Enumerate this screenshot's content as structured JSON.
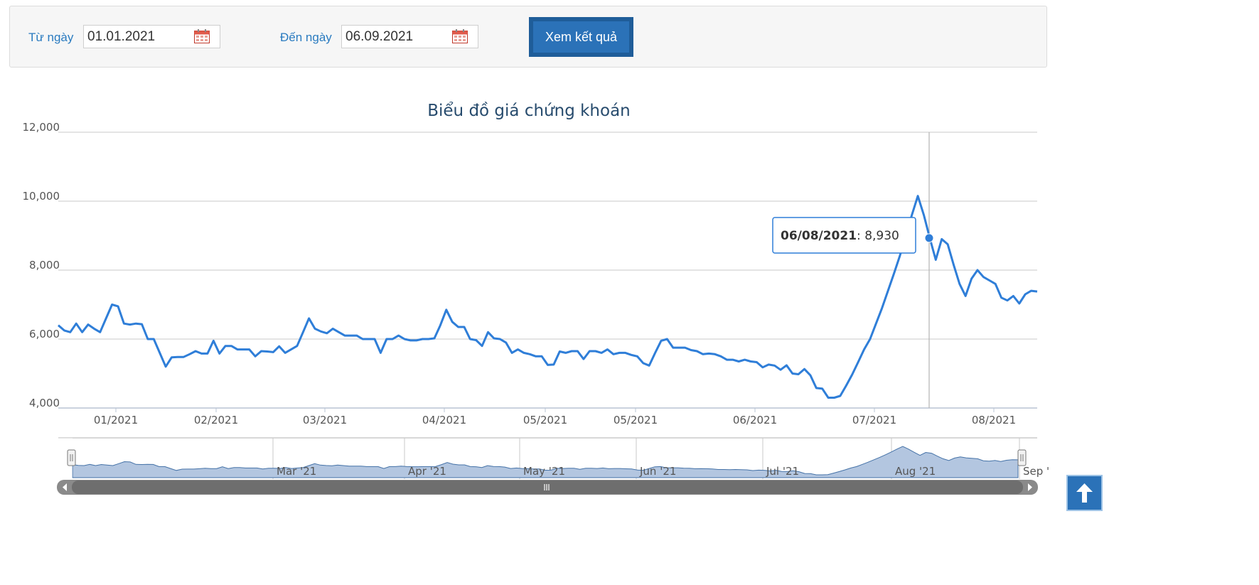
{
  "filter": {
    "from_label": "Từ ngày",
    "from_value": "01.01.2021",
    "to_label": "Đến ngày",
    "to_value": "06.09.2021",
    "submit_label": "Xem kết quả"
  },
  "icons": {
    "calendar": "calendar-icon",
    "scroll_top": "arrow-up-icon",
    "navigator_left": "arrow-left-icon",
    "navigator_right": "arrow-right-icon"
  },
  "colors": {
    "accent": "#2b72b8",
    "line": "#2f7ed8",
    "navigator_fill": "#b3c6e0",
    "label": "#2a7bc0"
  },
  "tooltip": {
    "date": "06/08/2021",
    "value": "8,930"
  },
  "chart_data": {
    "type": "line",
    "title": "Biểu đồ giá chứng khoán",
    "xlabel": "",
    "ylabel": "",
    "ylim": [
      4000,
      12000
    ],
    "yticks": [
      4000,
      6000,
      8000,
      10000,
      12000
    ],
    "ytick_labels": [
      "4,000",
      "6,000",
      "8,000",
      "10,000",
      "12,000"
    ],
    "xtick_labels": [
      "01/2021",
      "02/2021",
      "03/2021",
      "04/2021",
      "05/2021",
      "05/2021",
      "06/2021",
      "07/2021",
      "08/2021"
    ],
    "navigator_labels": [
      "Mar '21",
      "Apr '21",
      "May '21",
      "Jun '21",
      "Jul '21",
      "Aug '21",
      "Sep '"
    ],
    "grid": true,
    "legend": "none",
    "values": [
      6400,
      6250,
      6200,
      6450,
      6200,
      6420,
      6300,
      6200,
      6600,
      7000,
      6950,
      6450,
      6420,
      6450,
      6430,
      6000,
      6000,
      5600,
      5200,
      5470,
      5480,
      5480,
      5560,
      5650,
      5580,
      5580,
      5950,
      5580,
      5800,
      5800,
      5700,
      5700,
      5700,
      5500,
      5650,
      5640,
      5620,
      5790,
      5600,
      5700,
      5800,
      6200,
      6600,
      6300,
      6220,
      6170,
      6300,
      6200,
      6100,
      6100,
      6100,
      6000,
      6000,
      6000,
      5600,
      6000,
      6000,
      6100,
      6000,
      5960,
      5960,
      6000,
      6000,
      6020,
      6400,
      6850,
      6500,
      6350,
      6350,
      6000,
      5970,
      5800,
      6200,
      6020,
      6000,
      5900,
      5600,
      5700,
      5600,
      5560,
      5500,
      5500,
      5250,
      5260,
      5640,
      5600,
      5650,
      5650,
      5420,
      5650,
      5650,
      5600,
      5700,
      5560,
      5600,
      5600,
      5540,
      5500,
      5300,
      5230,
      5600,
      5950,
      6000,
      5750,
      5750,
      5750,
      5680,
      5650,
      5560,
      5580,
      5560,
      5500,
      5400,
      5400,
      5350,
      5400,
      5350,
      5330,
      5180,
      5260,
      5230,
      5110,
      5240,
      5000,
      4980,
      5130,
      4950,
      4580,
      4560,
      4300,
      4300,
      4350,
      4650,
      4970,
      5330,
      5700,
      6000,
      6450,
      6900,
      7400,
      7900,
      8420,
      9000,
      9600,
      10150,
      9600,
      8930,
      8300,
      8900,
      8750,
      8150,
      7600,
      7250,
      7750,
      8000,
      7800,
      7700,
      7600,
      7200,
      7120,
      7250,
      7030,
      7300,
      7400,
      7380
    ]
  }
}
